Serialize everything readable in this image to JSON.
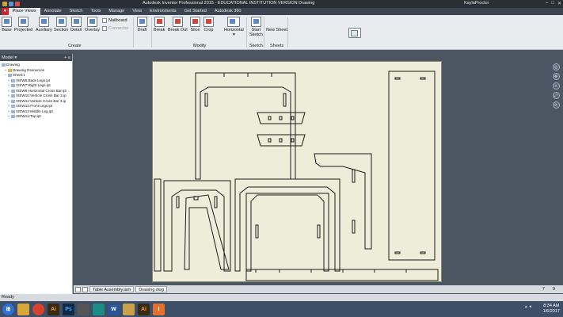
{
  "window": {
    "title": "Autodesk Inventor Professional 2015 - EDUCATIONAL INSTITUTION VERSION   Drawing",
    "user": "KaylaProctor",
    "controls": [
      "–",
      "□",
      "✕"
    ]
  },
  "ribbon_tabs": [
    {
      "label": "Place Views",
      "active": true
    },
    {
      "label": "Annotate"
    },
    {
      "label": "Sketch"
    },
    {
      "label": "Tools"
    },
    {
      "label": "Manage"
    },
    {
      "label": "View"
    },
    {
      "label": "Environments"
    },
    {
      "label": "Get Started"
    },
    {
      "label": "Autodesk 360"
    }
  ],
  "ribbon": {
    "create": {
      "base": "Base",
      "projected": "Projected",
      "auxiliary": "Auxiliary",
      "section": "Section",
      "detail": "Detail",
      "overlay": "Overlay",
      "nailboard": "Nailboard",
      "connector": "Connector",
      "panel": "Create"
    },
    "modify": {
      "draft": "Draft",
      "break": "Break",
      "break_out": "Break Out",
      "slice": "Slice",
      "crop": "Crop",
      "horizontal": "Horizontal",
      "panel": "Modify"
    },
    "sketch": {
      "start_sketch_1": "Start",
      "start_sketch_2": "Sketch",
      "panel": "Sketch"
    },
    "sheets": {
      "new_sheet": "New Sheet",
      "panel": "Sheets"
    }
  },
  "browser": {
    "header": "Model",
    "items": [
      {
        "label": "Drawing",
        "level": 0
      },
      {
        "label": "Drawing Resources",
        "level": 1
      },
      {
        "label": "Sheet:1",
        "level": 1
      },
      {
        "label": "VIEW6:Back Legs.ipt",
        "level": 2
      },
      {
        "label": "VIEW7:Right Legs.ipt",
        "level": 2
      },
      {
        "label": "VIEW9:Horizontal Cross Bar.ipt",
        "level": 2
      },
      {
        "label": "VIEW10:Verticle Cross Bar 3.ip",
        "level": 2
      },
      {
        "label": "VIEW11:Verticle Cross Bar 3.ip",
        "level": 2
      },
      {
        "label": "VIEW12:Front Legs.ipt",
        "level": 2
      },
      {
        "label": "VIEW13:Middle Leg.ipt",
        "level": 2
      },
      {
        "label": "VIEW14:Top.ipt",
        "level": 2
      }
    ]
  },
  "doc_tabs": [
    {
      "label": "Table Assembly.iam",
      "active": false
    },
    {
      "label": "Drawing.dwg",
      "active": true
    }
  ],
  "page_numbers": [
    "7",
    "9"
  ],
  "status": "Ready",
  "taskbar": {
    "apps": [
      {
        "name": "start",
        "label": "",
        "color": "#2d6fd6"
      },
      {
        "name": "explorer",
        "label": "",
        "color": "#d8a53a"
      },
      {
        "name": "chrome",
        "label": "",
        "color": "#d9412e"
      },
      {
        "name": "illustrator",
        "label": "Ai",
        "color": "#3a2a12"
      },
      {
        "name": "photoshop",
        "label": "Ps",
        "color": "#0e2a47"
      },
      {
        "name": "calculator",
        "label": "",
        "color": "#555"
      },
      {
        "name": "app-teal",
        "label": "",
        "color": "#1b8c86"
      },
      {
        "name": "word",
        "label": "W",
        "color": "#2a5699"
      },
      {
        "name": "app-diamond",
        "label": "",
        "color": "#c8a14a"
      },
      {
        "name": "illustrator-2",
        "label": "Ai",
        "color": "#3a2a12"
      },
      {
        "name": "inventor",
        "label": "I",
        "color": "#e4702b"
      }
    ],
    "time": "8:34 AM",
    "date": "1/6/2017"
  }
}
